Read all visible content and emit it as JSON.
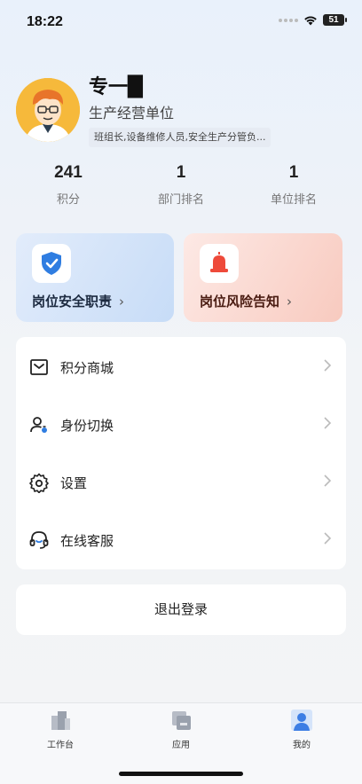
{
  "status_bar": {
    "time": "18:22",
    "battery": "51"
  },
  "profile": {
    "name": "专一█",
    "org": "生产经营单位",
    "roles": "班组长,设备维修人员,安全生产分管负..."
  },
  "stats": [
    {
      "value": "241",
      "label": "积分"
    },
    {
      "value": "1",
      "label": "部门排名"
    },
    {
      "value": "1",
      "label": "单位排名"
    }
  ],
  "cards": {
    "safety_duty": {
      "label": "岗位安全职责",
      "icon": "shield-check-icon",
      "color": "#2f7de1"
    },
    "risk_notice": {
      "label": "岗位风险告知",
      "icon": "alarm-bell-icon",
      "color": "#ee4a3a"
    }
  },
  "menu": [
    {
      "label": "积分商城",
      "icon": "mall-icon"
    },
    {
      "label": "身份切换",
      "icon": "user-switch-icon"
    },
    {
      "label": "设置",
      "icon": "gear-icon"
    },
    {
      "label": "在线客服",
      "icon": "headset-icon"
    }
  ],
  "logout_label": "退出登录",
  "tabs": [
    {
      "label": "工作台",
      "icon": "workbench-icon"
    },
    {
      "label": "应用",
      "icon": "apps-icon"
    },
    {
      "label": "我的",
      "icon": "profile-icon",
      "active": true
    }
  ]
}
